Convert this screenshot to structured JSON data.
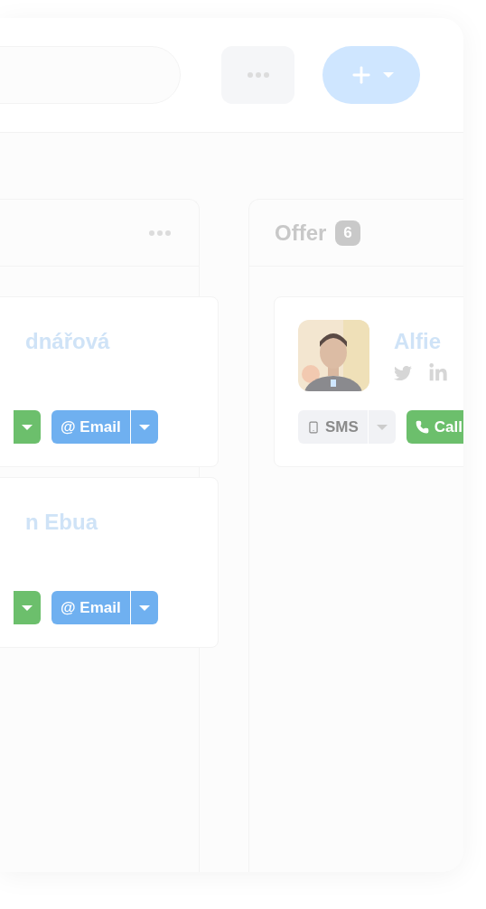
{
  "columns": [
    {
      "cards": [
        {
          "name": "dnářová",
          "actions": [
            {
              "kind": "call"
            },
            {
              "kind": "email",
              "label": "@ Email"
            }
          ]
        },
        {
          "name": "n Ebua",
          "actions": [
            {
              "kind": "call"
            },
            {
              "kind": "email",
              "label": "@ Email"
            }
          ]
        }
      ]
    },
    {
      "title": "Offer",
      "count": "6",
      "cards": [
        {
          "name": "Alfie",
          "actions": [
            {
              "kind": "sms",
              "label": "SMS"
            },
            {
              "kind": "call",
              "label": "Call"
            }
          ]
        }
      ]
    }
  ]
}
